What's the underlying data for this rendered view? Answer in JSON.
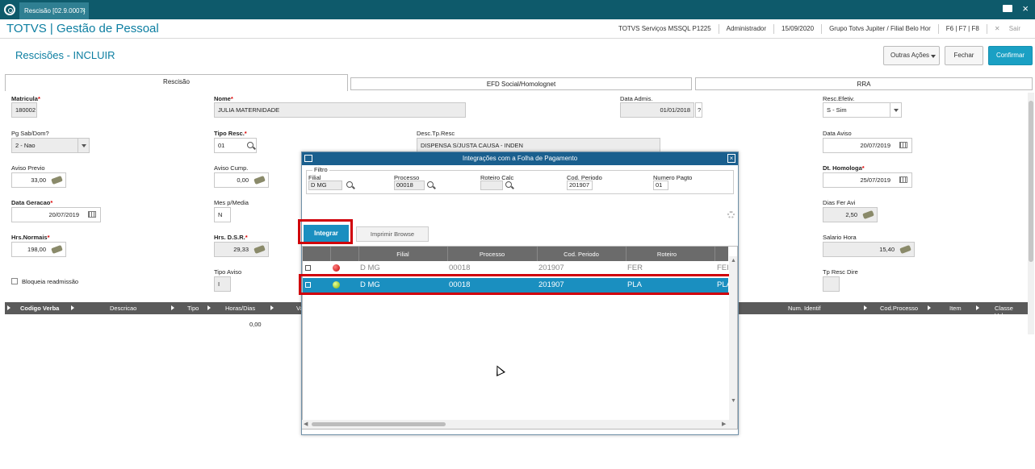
{
  "topbar": {
    "tab_label": "Rescisão [02.9.0007]",
    "tab_close": "×"
  },
  "titlebar": {
    "brand": "TOTVS | Gestão de Pessoal",
    "server": "TOTVS Serviços MSSQL P1225",
    "user": "Administrador",
    "date": "15/09/2020",
    "company": "Grupo Totvs Jupiter / Filial Belo Hor",
    "keys": "F6 | F7 | F8",
    "exit": "Sair"
  },
  "page": {
    "title": "Rescisões - INCLUIR",
    "btn_outras": "Outras Ações",
    "btn_fechar": "Fechar",
    "btn_confirmar": "Confirmar"
  },
  "tabs": [
    "Rescisão",
    "EFD Social/Homolognet",
    "RRA"
  ],
  "form": {
    "matricula_label": "Matricula",
    "matricula": "180002",
    "nome_label": "Nome",
    "nome": "JULIA MATERNIDADE",
    "data_admis_label": "Data Admis.",
    "data_admis": "01/01/2018",
    "resc_efetiv_label": "Resc.Efetiv.",
    "resc_efetiv": "S - Sim",
    "pg_sab_label": "Pg Sab/Dom?",
    "pg_sab": "2 - Nao",
    "tipo_resc_label": "Tipo Resc.",
    "tipo_resc": "01",
    "desc_tp_resc_label": "Desc.Tp.Resc",
    "desc_tp_resc": "DISPENSA S/JUSTA CAUSA - INDEN",
    "data_aviso_label": "Data Aviso",
    "data_aviso": "20/07/2019",
    "aviso_previo_label": "Aviso Previo",
    "aviso_previo": "33,00",
    "aviso_cump_label": "Aviso Cump.",
    "aviso_cump": "0,00",
    "dt_homologa_label": "Dt. Homologa",
    "dt_homologa": "25/07/2019",
    "data_geracao_label": "Data Geracao",
    "data_geracao": "20/07/2019",
    "mes_media_label": "Mes p/Media",
    "mes_media": "N",
    "dias_fer_label": "Dias Fer Avi",
    "dias_fer": "2,50",
    "hrs_normais_label": "Hrs.Normais",
    "hrs_normais": "198,00",
    "hrs_dsr_label": "Hrs. D.S.R.",
    "hrs_dsr": "29,33",
    "salario_hora_label": "Salario Hora",
    "salario_hora": "15,40",
    "bloqueia_label": "Bloqueia readmissão",
    "tipo_aviso_label": "Tipo Aviso",
    "tipo_aviso": "I",
    "tp_resc_dire_label": "Tp Resc Dire"
  },
  "grid": {
    "columns_left": [
      "Codigo Verba",
      "Descricao",
      "Tipo",
      "Horas/Dias",
      "Va"
    ],
    "columns_right": [
      "Num. Identif",
      "Cod.Processo",
      "Item",
      "Classe Valor"
    ],
    "value": "0,00"
  },
  "modal": {
    "title": "Integrações com a Folha de Pagamento",
    "filtro": "Filtro",
    "filial_label": "Filial",
    "filial": "D MG",
    "processo_label": "Processo",
    "processo": "00018",
    "roteiro_label": "Roteiro Calc",
    "roteiro": "",
    "cod_periodo_label": "Cod. Periodo",
    "cod_periodo": "201907",
    "numero_pagto_label": "Numero Pagto",
    "numero_pagto": "01",
    "btn_integrar": "Integrar",
    "btn_imprimir": "Imprimir Browse",
    "columns": [
      "Filial",
      "Processo",
      "Cod. Periodo",
      "Roteiro"
    ],
    "rows": [
      {
        "filial": "D MG",
        "processo": "00018",
        "periodo": "201907",
        "roteiro": "FER",
        "extra": "FEI"
      },
      {
        "filial": "D MG",
        "processo": "00018",
        "periodo": "201907",
        "roteiro": "PLA",
        "extra": "PLA"
      }
    ]
  }
}
